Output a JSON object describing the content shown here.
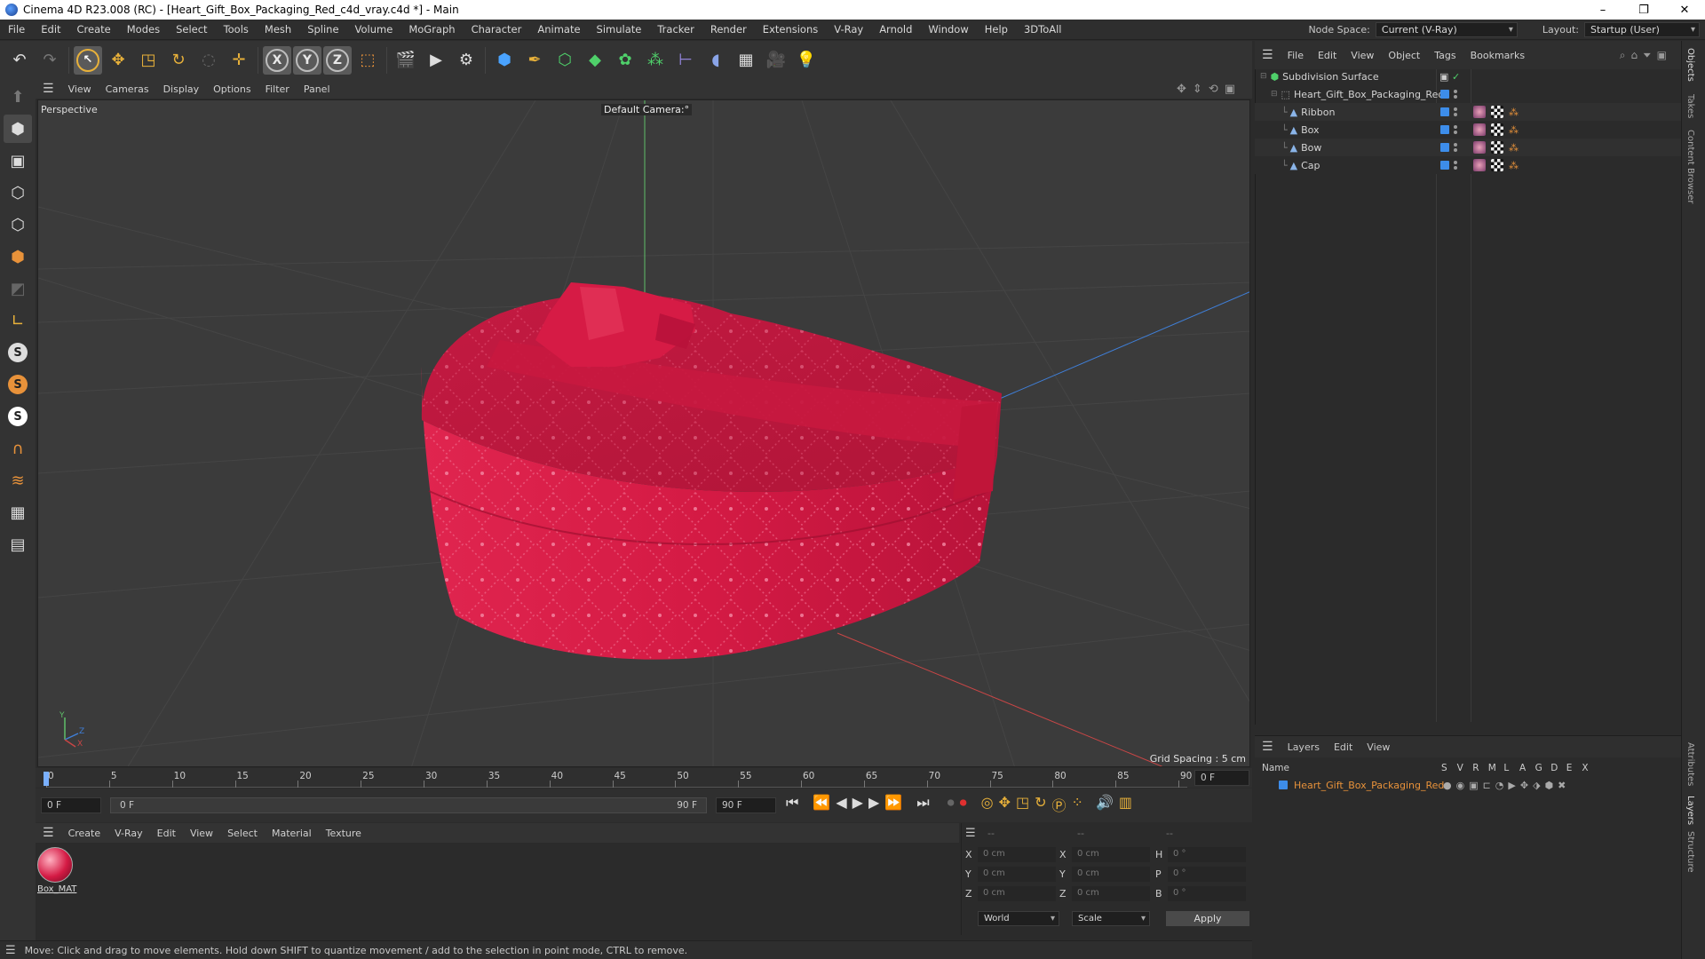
{
  "title": "Cinema 4D R23.008 (RC) - [Heart_Gift_Box_Packaging_Red_c4d_vray.c4d *] - Main",
  "window_controls": {
    "minimize": "–",
    "maximize": "❐",
    "close": "✕"
  },
  "menu": [
    "File",
    "Edit",
    "Create",
    "Modes",
    "Select",
    "Tools",
    "Mesh",
    "Spline",
    "Volume",
    "MoGraph",
    "Character",
    "Animate",
    "Simulate",
    "Tracker",
    "Render",
    "Extensions",
    "V-Ray",
    "Arnold",
    "Window",
    "Help",
    "3DToAll"
  ],
  "node_space": {
    "label": "Node Space:",
    "value": "Current (V-Ray)"
  },
  "layout": {
    "label": "Layout:",
    "value": "Startup (User)"
  },
  "toolbar_axes": [
    "X",
    "Y",
    "Z"
  ],
  "viewport": {
    "menu": [
      "View",
      "Cameras",
      "Display",
      "Options",
      "Filter",
      "Panel"
    ],
    "name": "Perspective",
    "camera": "Default Camera",
    "camera_suffix": ":°",
    "grid_spacing": "Grid Spacing : 5 cm",
    "axis_labels": {
      "y": "Y",
      "z": "Z",
      "x": "X"
    }
  },
  "timeline": {
    "ticks": [
      "0",
      "5",
      "10",
      "15",
      "20",
      "25",
      "30",
      "35",
      "40",
      "45",
      "50",
      "55",
      "60",
      "65",
      "70",
      "75",
      "80",
      "85",
      "90"
    ],
    "current_frame": "0 F",
    "start": "0 F",
    "range_start": "0 F",
    "range_end": "90 F",
    "end": "90 F"
  },
  "material_manager": {
    "menu": [
      "Create",
      "V-Ray",
      "Edit",
      "View",
      "Select",
      "Material",
      "Texture"
    ],
    "materials": [
      {
        "name": "Box_MAT"
      }
    ]
  },
  "coordinates": {
    "headers": [
      "--",
      "--",
      "--"
    ],
    "rows": [
      {
        "a": "X",
        "av": "0 cm",
        "b": "X",
        "bv": "0 cm",
        "c": "H",
        "cv": "0 °"
      },
      {
        "a": "Y",
        "av": "0 cm",
        "b": "Y",
        "bv": "0 cm",
        "c": "P",
        "cv": "0 °"
      },
      {
        "a": "Z",
        "av": "0 cm",
        "b": "Z",
        "bv": "0 cm",
        "c": "B",
        "cv": "0 °"
      }
    ],
    "mode": "World",
    "transform": "Scale",
    "apply": "Apply"
  },
  "status": "Move: Click and drag to move elements. Hold down SHIFT to quantize movement / add to the selection in point mode, CTRL to remove.",
  "object_manager": {
    "menu": [
      "File",
      "Edit",
      "View",
      "Object",
      "Tags",
      "Bookmarks"
    ],
    "objects": [
      {
        "name": "Subdivision Surface"
      },
      {
        "name": "Heart_Gift_Box_Packaging_Red"
      },
      {
        "name": "Ribbon"
      },
      {
        "name": "Box"
      },
      {
        "name": "Bow"
      },
      {
        "name": "Cap"
      }
    ]
  },
  "layers": {
    "menu": [
      "Layers",
      "Edit",
      "View"
    ],
    "columns": [
      "Name",
      "S",
      "V",
      "R",
      "M",
      "L",
      "A",
      "G",
      "D",
      "E",
      "X"
    ],
    "items": [
      {
        "name": "Heart_Gift_Box_Packaging_Red",
        "color": "#3d8dea"
      }
    ]
  },
  "side_tabs": [
    "Objects",
    "Takes",
    "Content Browser",
    "Attributes",
    "Layers",
    "Structure"
  ],
  "colors": {
    "accent": "#3d8dea",
    "box": "#d81b46",
    "layer_text": "#e8923a"
  }
}
